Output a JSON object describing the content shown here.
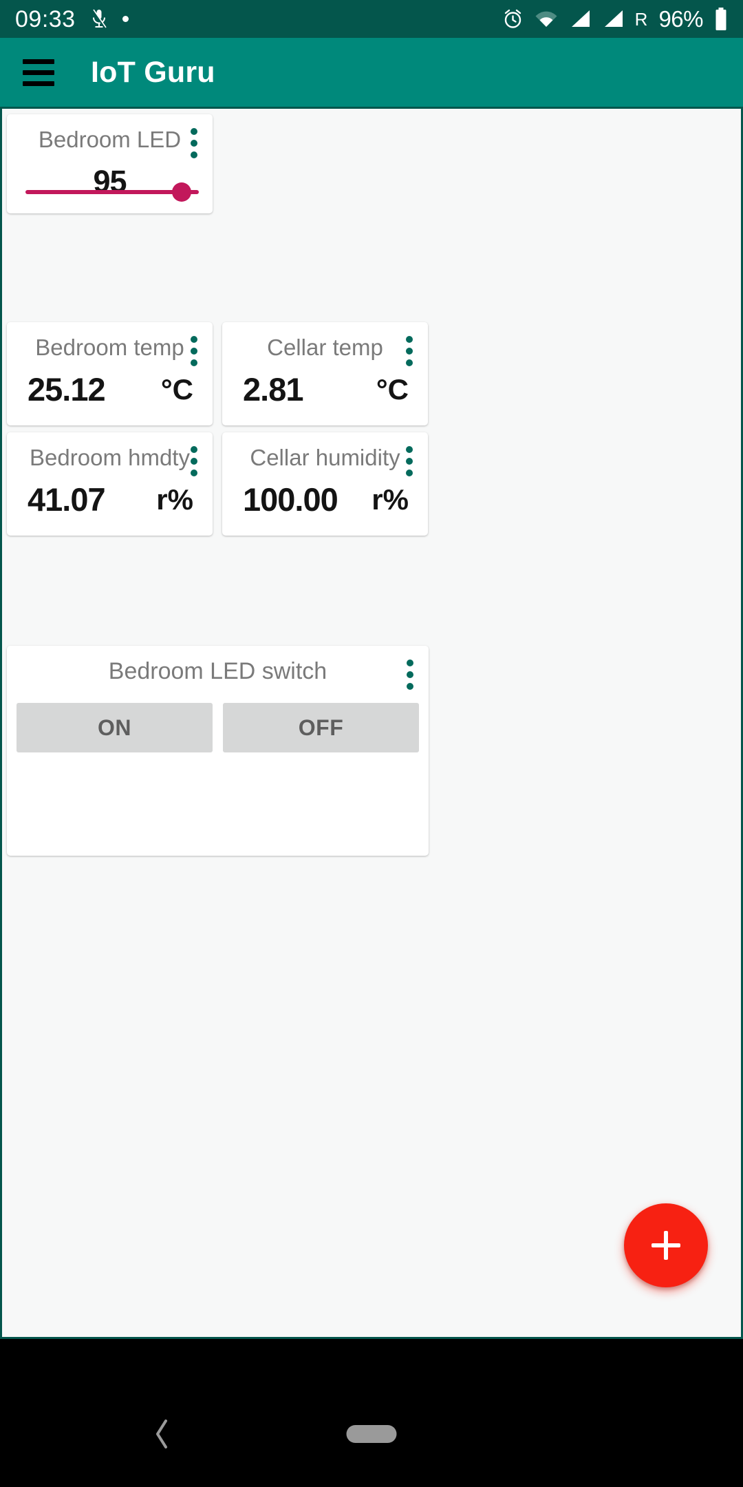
{
  "status_bar": {
    "time": "09:33",
    "icons_left": [
      "mic-icon",
      "dot-icon"
    ],
    "icons_right": [
      "alarm-icon",
      "wifi-icon",
      "signal-icon",
      "signal-icon"
    ],
    "roaming": "R",
    "battery": "96%",
    "background_color": "#04564C"
  },
  "app_bar": {
    "title": "IoT Guru",
    "menu_icon": "hamburger-icon",
    "background_color": "#00897B"
  },
  "cards": {
    "led_slider": {
      "title": "Bedroom LED",
      "value": "95",
      "slider_percent": 95,
      "accent_color": "#C2185B"
    },
    "sensors": [
      {
        "title": "Bedroom temp",
        "value": "25.12",
        "unit": "°C"
      },
      {
        "title": "Cellar temp",
        "value": "2.81",
        "unit": "°C"
      },
      {
        "title": "Bedroom hmdty",
        "value": "41.07",
        "unit": "r%"
      },
      {
        "title": "Cellar humidity",
        "value": "100.00",
        "unit": "r%"
      }
    ],
    "led_switch": {
      "title": "Bedroom LED switch",
      "on_label": "ON",
      "off_label": "OFF"
    }
  },
  "fab": {
    "icon": "plus-icon",
    "color": "#F72112"
  },
  "nav_bar": {
    "back_icon": "chevron-left-icon",
    "home_icon": "home-pill-icon"
  }
}
